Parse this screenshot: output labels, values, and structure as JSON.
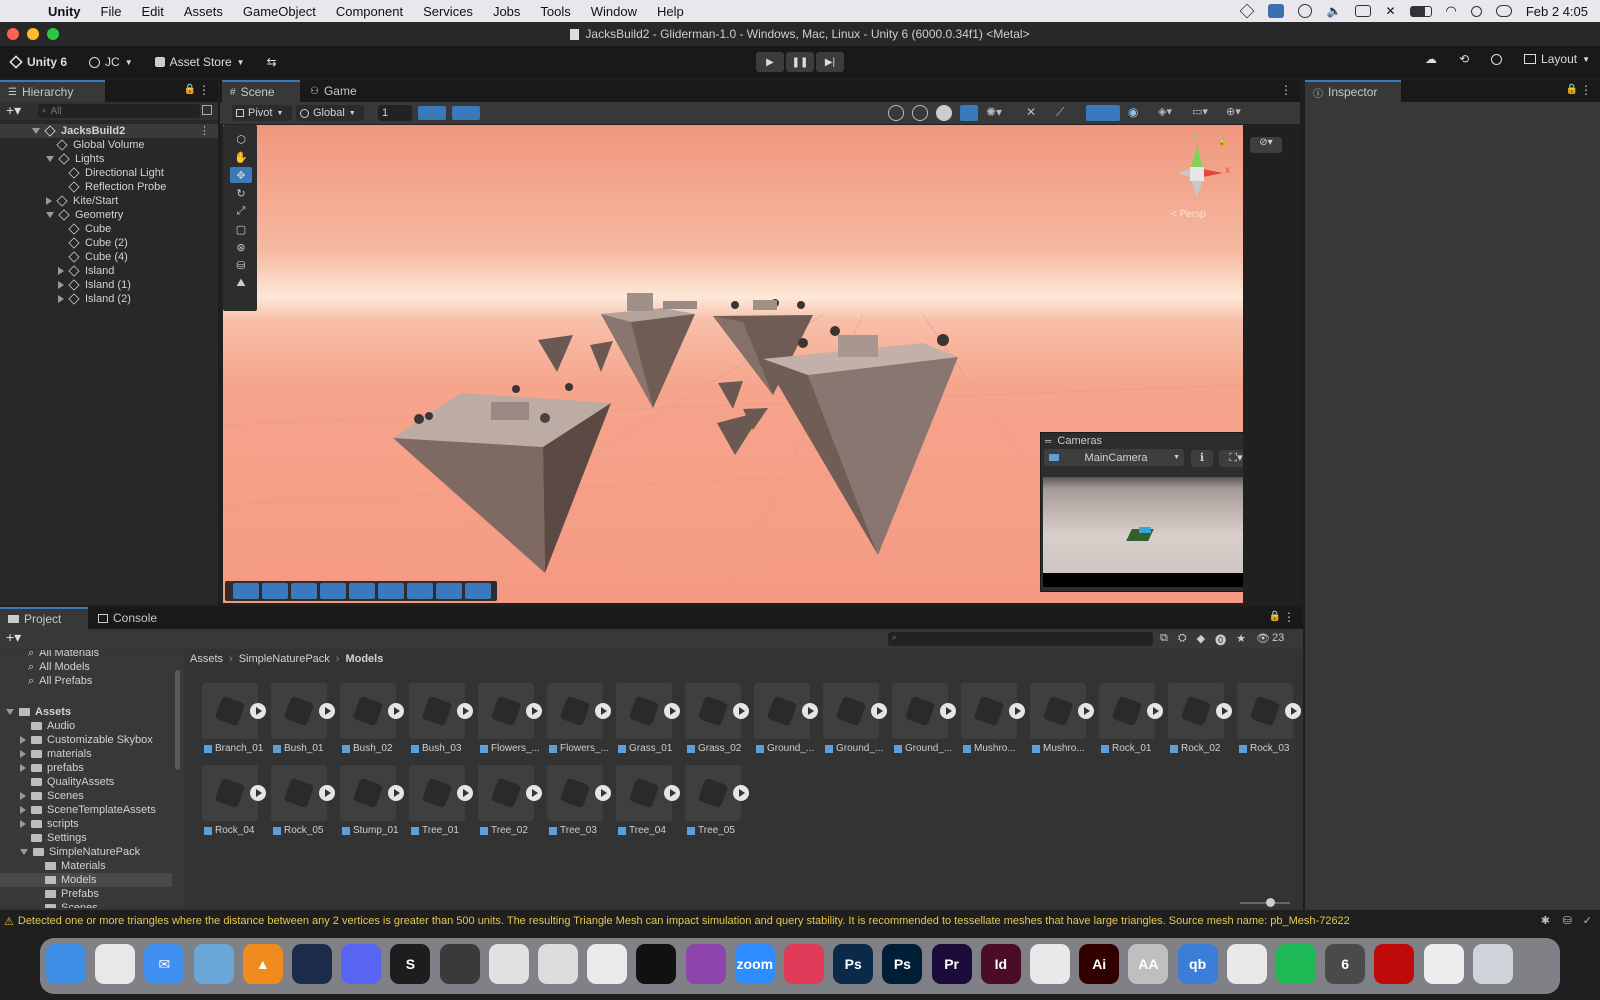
{
  "menubar": {
    "items": [
      "Unity",
      "File",
      "Edit",
      "Assets",
      "GameObject",
      "Component",
      "Services",
      "Jobs",
      "Tools",
      "Window",
      "Help"
    ],
    "clock": "Feb 2  4:05"
  },
  "window": {
    "title": "JacksBuild2 - Gliderman-1.0 - Windows, Mac, Linux - Unity 6 (6000.0.34f1) <Metal>"
  },
  "toolbar": {
    "unity_label": "Unity 6",
    "account": "JC",
    "asset_store": "Asset Store",
    "layout": "Layout"
  },
  "hierarchy": {
    "tab": "Hierarchy",
    "search_placeholder": "All",
    "root": "JacksBuild2",
    "items": [
      {
        "label": "Global Volume",
        "depth": 1,
        "arrow": ""
      },
      {
        "label": "Lights",
        "depth": 1,
        "arrow": "down"
      },
      {
        "label": "Directional Light",
        "depth": 2,
        "arrow": ""
      },
      {
        "label": "Reflection Probe",
        "depth": 2,
        "arrow": ""
      },
      {
        "label": "Kite/Start",
        "depth": 1,
        "arrow": "right"
      },
      {
        "label": "Geometry",
        "depth": 1,
        "arrow": "down"
      },
      {
        "label": "Cube",
        "depth": 2,
        "arrow": ""
      },
      {
        "label": "Cube (2)",
        "depth": 2,
        "arrow": ""
      },
      {
        "label": "Cube (4)",
        "depth": 2,
        "arrow": ""
      },
      {
        "label": "Island",
        "depth": 2,
        "arrow": "right"
      },
      {
        "label": "Island (1)",
        "depth": 2,
        "arrow": "right"
      },
      {
        "label": "Island (2)",
        "depth": 2,
        "arrow": "right"
      }
    ]
  },
  "scene": {
    "tabs": [
      "Scene",
      "Game"
    ],
    "pivot": "Pivot",
    "global": "Global",
    "grid_value": "1",
    "persp": "< Persp",
    "gizmo_y": "y",
    "gizmo_x": "x"
  },
  "cameras_overlay": {
    "title": "Cameras",
    "selected": "MainCamera"
  },
  "inspector": {
    "tab": "Inspector"
  },
  "project": {
    "tabs": [
      "Project",
      "Console"
    ],
    "count": "23",
    "breadcrumb": [
      "Assets",
      "SimpleNaturePack",
      "Models"
    ],
    "favorites": [
      "All Materials",
      "All Models",
      "All Prefabs"
    ],
    "tree_root": "Assets",
    "tree": [
      {
        "label": "Audio",
        "depth": 1,
        "arrow": ""
      },
      {
        "label": "Customizable Skybox",
        "depth": 1,
        "arrow": "right"
      },
      {
        "label": "materials",
        "depth": 1,
        "arrow": "right"
      },
      {
        "label": "prefabs",
        "depth": 1,
        "arrow": "right"
      },
      {
        "label": "QualityAssets",
        "depth": 1,
        "arrow": ""
      },
      {
        "label": "Scenes",
        "depth": 1,
        "arrow": "right"
      },
      {
        "label": "SceneTemplateAssets",
        "depth": 1,
        "arrow": "right"
      },
      {
        "label": "scripts",
        "depth": 1,
        "arrow": "right"
      },
      {
        "label": "Settings",
        "depth": 1,
        "arrow": ""
      },
      {
        "label": "SimpleNaturePack",
        "depth": 1,
        "arrow": "down"
      },
      {
        "label": "Materials",
        "depth": 2,
        "arrow": ""
      },
      {
        "label": "Models",
        "depth": 2,
        "arrow": ""
      },
      {
        "label": "Prefabs",
        "depth": 2,
        "arrow": ""
      },
      {
        "label": "Scenes",
        "depth": 2,
        "arrow": ""
      }
    ],
    "assets": [
      "Branch_01",
      "Bush_01",
      "Bush_02",
      "Bush_03",
      "Flowers_...",
      "Flowers_...",
      "Grass_01",
      "Grass_02",
      "Ground_...",
      "Ground_...",
      "Ground_...",
      "Mushro...",
      "Mushro...",
      "Rock_01",
      "Rock_02",
      "Rock_03",
      "Rock_04",
      "Rock_05",
      "Stump_01",
      "Tree_01",
      "Tree_02",
      "Tree_03",
      "Tree_04",
      "Tree_05"
    ]
  },
  "status": {
    "message": "Detected one or more triangles where the distance between any 2 vertices is greater than 500 units. The resulting Triangle Mesh can impact simulation and query stability. It is recommended to tessellate meshes that have large triangles. Source mesh name: pb_Mesh-72622"
  },
  "dock": [
    {
      "name": "finder",
      "text": "",
      "color": "#3b8de6"
    },
    {
      "name": "launchpad",
      "text": "",
      "color": "#e8e8e8"
    },
    {
      "name": "mail",
      "text": "✉",
      "color": "#3f8ff0"
    },
    {
      "name": "preview",
      "text": "",
      "color": "#6aa6d8"
    },
    {
      "name": "vlc",
      "text": "▲",
      "color": "#f08a1c"
    },
    {
      "name": "steam",
      "text": "",
      "color": "#1b2c4a"
    },
    {
      "name": "discord",
      "text": "",
      "color": "#5865f2"
    },
    {
      "name": "sketchbook",
      "text": "S",
      "color": "#1d1d1d"
    },
    {
      "name": "unity-hub",
      "text": "",
      "color": "#3a3a3a"
    },
    {
      "name": "blender",
      "text": "",
      "color": "#e2e2e2"
    },
    {
      "name": "cursor",
      "text": "",
      "color": "#dcdcdc"
    },
    {
      "name": "vscode",
      "text": "",
      "color": "#eaeaea"
    },
    {
      "name": "unity",
      "text": "",
      "color": "#111111"
    },
    {
      "name": "github",
      "text": "",
      "color": "#8e44ad"
    },
    {
      "name": "zoom",
      "text": "zoom",
      "color": "#2d8cff"
    },
    {
      "name": "creative-cloud",
      "text": "",
      "color": "#e23b5a"
    },
    {
      "name": "photoshop-express",
      "text": "Ps",
      "color": "#0b2a4a"
    },
    {
      "name": "photoshop",
      "text": "Ps",
      "color": "#001e36"
    },
    {
      "name": "premiere",
      "text": "Pr",
      "color": "#1a0b3b"
    },
    {
      "name": "indesign",
      "text": "Id",
      "color": "#4b0c25"
    },
    {
      "name": "acrobat",
      "text": "",
      "color": "#e9e9e9"
    },
    {
      "name": "illustrator",
      "text": "Ai",
      "color": "#330000"
    },
    {
      "name": "font-book",
      "text": "AA",
      "color": "#bfbfbf"
    },
    {
      "name": "qbittorrent",
      "text": "qb",
      "color": "#3b7ed8"
    },
    {
      "name": "chrome",
      "text": "",
      "color": "#e8e8e8"
    },
    {
      "name": "spotify",
      "text": "",
      "color": "#1db954"
    },
    {
      "name": "unity-6",
      "text": "6",
      "color": "#4a4a4a"
    },
    {
      "name": "acrobat-reader",
      "text": "",
      "color": "#c00a0a"
    },
    {
      "name": "document",
      "text": "",
      "color": "#eeeeee"
    },
    {
      "name": "trash",
      "text": "",
      "color": "#cfd4da"
    }
  ]
}
